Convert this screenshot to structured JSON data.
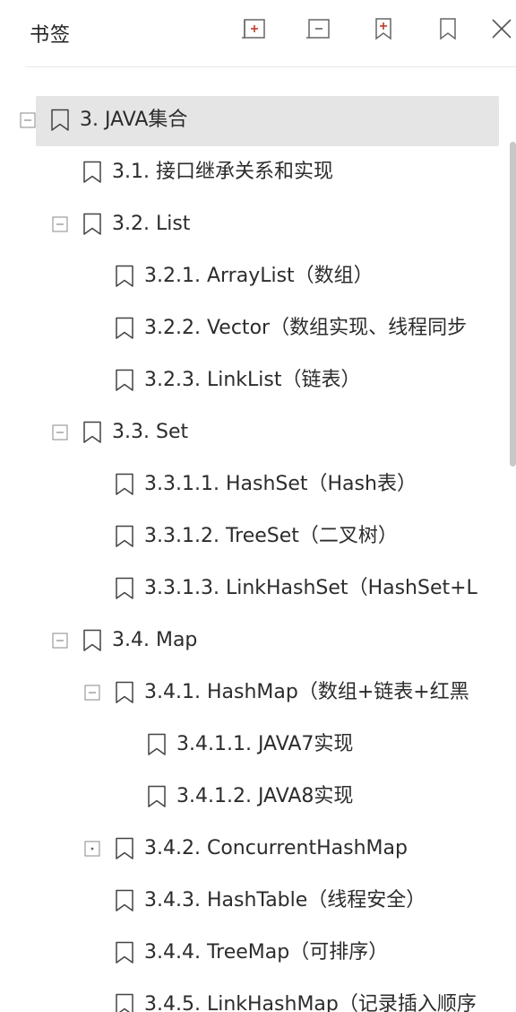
{
  "header": {
    "title": "书签",
    "buttons": [
      {
        "name": "expand-all-icon"
      },
      {
        "name": "collapse-all-icon"
      },
      {
        "name": "add-bookmark-icon"
      },
      {
        "name": "bookmark-icon"
      },
      {
        "name": "close-icon"
      }
    ]
  },
  "tree": [
    {
      "label": "3. JAVA集合",
      "level": 0,
      "toggle": "collapse",
      "selected": true
    },
    {
      "label": "3.1. 接口继承关系和实现",
      "level": 1,
      "toggle": "none"
    },
    {
      "label": "3.2. List",
      "level": 1,
      "toggle": "collapse"
    },
    {
      "label": "3.2.1. ArrayList（数组）",
      "level": 2,
      "toggle": "none"
    },
    {
      "label": "3.2.2. Vector（数组实现、线程同步",
      "level": 2,
      "toggle": "none"
    },
    {
      "label": "3.2.3. LinkList（链表）",
      "level": 2,
      "toggle": "none"
    },
    {
      "label": "3.3. Set",
      "level": 1,
      "toggle": "collapse"
    },
    {
      "label": "3.3.1.1. HashSet（Hash表）",
      "level": 2,
      "toggle": "none"
    },
    {
      "label": "3.3.1.2. TreeSet（二叉树）",
      "level": 2,
      "toggle": "none"
    },
    {
      "label": "3.3.1.3. LinkHashSet（HashSet+L",
      "level": 2,
      "toggle": "none"
    },
    {
      "label": "3.4. Map",
      "level": 1,
      "toggle": "collapse"
    },
    {
      "label": "3.4.1. HashMap（数组+链表+红黑",
      "level": 2,
      "toggle": "collapse"
    },
    {
      "label": "3.4.1.1. JAVA7实现",
      "level": 3,
      "toggle": "none"
    },
    {
      "label": "3.4.1.2. JAVA8实现",
      "level": 3,
      "toggle": "none"
    },
    {
      "label": "3.4.2. ConcurrentHashMap",
      "level": 2,
      "toggle": "expand"
    },
    {
      "label": "3.4.3. HashTable（线程安全）",
      "level": 2,
      "toggle": "none"
    },
    {
      "label": "3.4.4. TreeMap（可排序）",
      "level": 2,
      "toggle": "none"
    },
    {
      "label": "3.4.5. LinkHashMap（记录插入顺序",
      "level": 2,
      "toggle": "none"
    }
  ]
}
